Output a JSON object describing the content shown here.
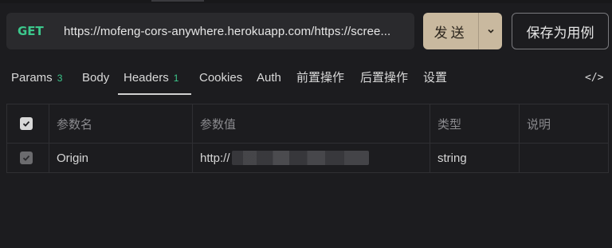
{
  "request": {
    "method": "GET",
    "url": "https://mofeng-cors-anywhere.herokuapp.com/https://scree..."
  },
  "actions": {
    "send_label": "发送",
    "save_label": "保存为用例"
  },
  "tabs": [
    {
      "label": "Params",
      "badge": "3"
    },
    {
      "label": "Body"
    },
    {
      "label": "Headers",
      "badge": "1",
      "active": true
    },
    {
      "label": "Cookies"
    },
    {
      "label": "Auth"
    },
    {
      "label": "前置操作"
    },
    {
      "label": "后置操作"
    },
    {
      "label": "设置"
    }
  ],
  "code_icon_label": "</>",
  "headers_table": {
    "columns": [
      "参数名",
      "参数值",
      "类型",
      "说明"
    ],
    "rows": [
      {
        "enabled": true,
        "name": "Origin",
        "value": "http://",
        "type": "string",
        "description": ""
      }
    ]
  },
  "colors": {
    "method_get": "#3cc88c",
    "send_button": "#c9b99f",
    "background": "#1c1c1f"
  }
}
